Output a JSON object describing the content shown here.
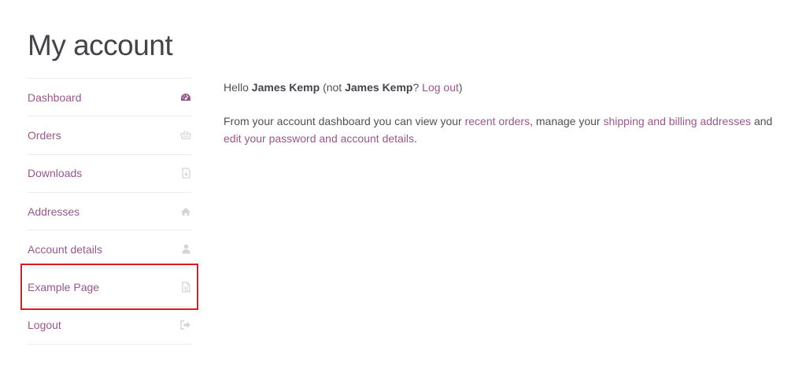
{
  "page": {
    "title": "My account"
  },
  "nav": {
    "items": [
      {
        "label": "Dashboard",
        "icon": "dashboard-icon"
      },
      {
        "label": "Orders",
        "icon": "basket-icon"
      },
      {
        "label": "Downloads",
        "icon": "file-download-icon"
      },
      {
        "label": "Addresses",
        "icon": "home-icon"
      },
      {
        "label": "Account details",
        "icon": "user-icon"
      },
      {
        "label": "Example Page",
        "icon": "file-icon"
      },
      {
        "label": "Logout",
        "icon": "sign-out-icon"
      }
    ]
  },
  "content": {
    "greeting_hello": "Hello ",
    "greeting_name": "James Kemp",
    "greeting_not": " (not ",
    "greeting_name2": "James Kemp",
    "greeting_q": "? ",
    "logout_link": "Log out",
    "greeting_close": ")",
    "desc_1": "From your account dashboard you can view your ",
    "recent_orders_link": "recent orders",
    "desc_2": ", manage your ",
    "addresses_link": "shipping and billing addresses",
    "desc_3": " and ",
    "account_link": "edit your password and account details",
    "desc_4": "."
  },
  "colors": {
    "link": "#96588a",
    "active_icon": "#96588a",
    "icon": "#d4d4d4",
    "highlight_border": "#e0191f"
  }
}
